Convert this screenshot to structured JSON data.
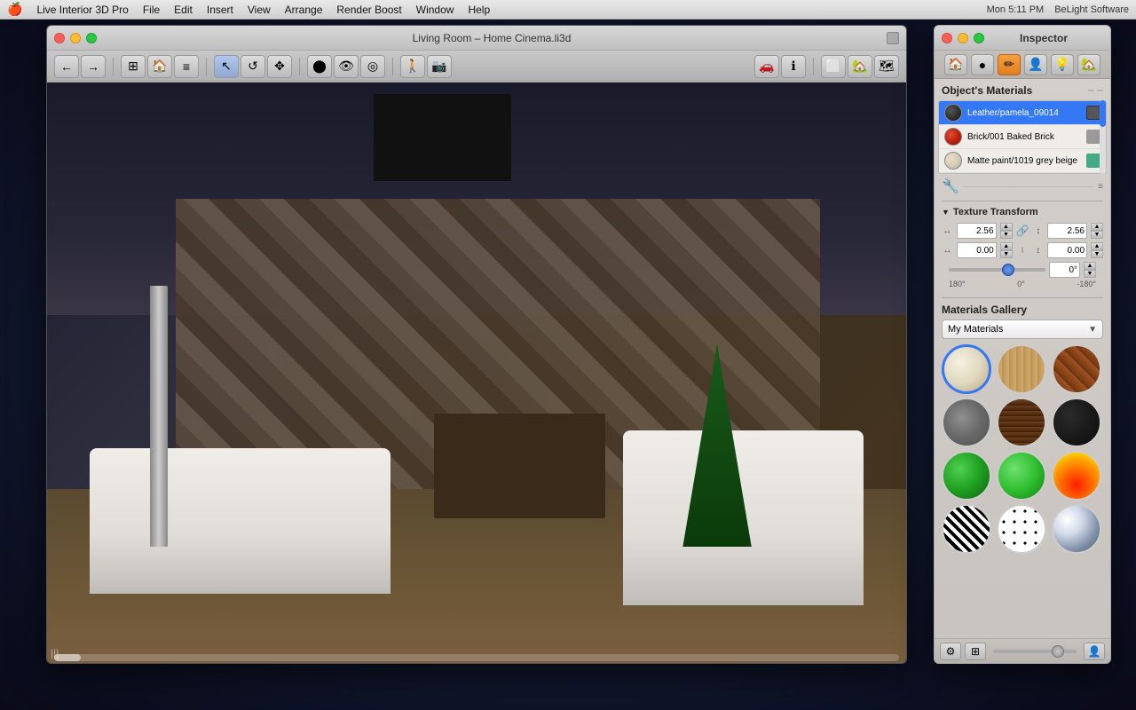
{
  "menubar": {
    "apple": "🍎",
    "items": [
      {
        "label": "Live Interior 3D Pro"
      },
      {
        "label": "File"
      },
      {
        "label": "Edit"
      },
      {
        "label": "Insert"
      },
      {
        "label": "View"
      },
      {
        "label": "Arrange"
      },
      {
        "label": "Render Boost"
      },
      {
        "label": "Window"
      },
      {
        "label": "Help"
      }
    ],
    "right_items": [
      {
        "label": "Mon 5:11 PM"
      },
      {
        "label": "BeLight Software"
      }
    ]
  },
  "main_window": {
    "title": "Living Room – Home Cinema.li3d",
    "scrollbar_label": "|||"
  },
  "inspector": {
    "title": "Inspector",
    "tabs": [
      {
        "label": "🏠",
        "icon": "house-icon",
        "active": false
      },
      {
        "label": "●",
        "icon": "circle-icon",
        "active": true
      },
      {
        "label": "✏️",
        "icon": "pencil-icon",
        "active": false
      },
      {
        "label": "👤",
        "icon": "person-icon",
        "active": false
      },
      {
        "label": "💡",
        "icon": "light-icon",
        "active": false
      },
      {
        "label": "🏠",
        "icon": "house2-icon",
        "active": false
      }
    ],
    "object_materials": {
      "header": "Object's Materials",
      "items": [
        {
          "name": "Leather/pamela_09014",
          "swatch_class": "swatch-leather",
          "selected": true
        },
        {
          "name": "Brick/001 Baked Brick",
          "swatch_class": "swatch-red"
        },
        {
          "name": "Matte paint/1019 grey beige",
          "swatch_class": "swatch-matte"
        }
      ]
    },
    "texture_transform": {
      "header": "Texture Transform",
      "row1": {
        "icon1": "↔",
        "val1": "2.56",
        "icon2": "↕",
        "val2": "2.56"
      },
      "row2": {
        "icon1": "↔",
        "val1": "0.00",
        "icon2": "↕",
        "val2": "0.00"
      },
      "angle_label_left": "180°",
      "angle_label_center": "0°",
      "angle_label_right": "-180°",
      "angle_value": "0°"
    },
    "gallery": {
      "header": "Materials Gallery",
      "dropdown_label": "My Materials",
      "items": [
        {
          "class": "swatch-cream",
          "selected": true
        },
        {
          "class": "swatch-wood-light"
        },
        {
          "class": "swatch-brick"
        },
        {
          "class": "swatch-concrete"
        },
        {
          "class": "swatch-dark-wood"
        },
        {
          "class": "swatch-very-dark"
        },
        {
          "class": "swatch-green"
        },
        {
          "class": "swatch-bright-green"
        },
        {
          "class": "swatch-fire"
        },
        {
          "class": "swatch-zebra"
        },
        {
          "class": "swatch-spots"
        },
        {
          "class": "swatch-chrome"
        }
      ]
    }
  }
}
